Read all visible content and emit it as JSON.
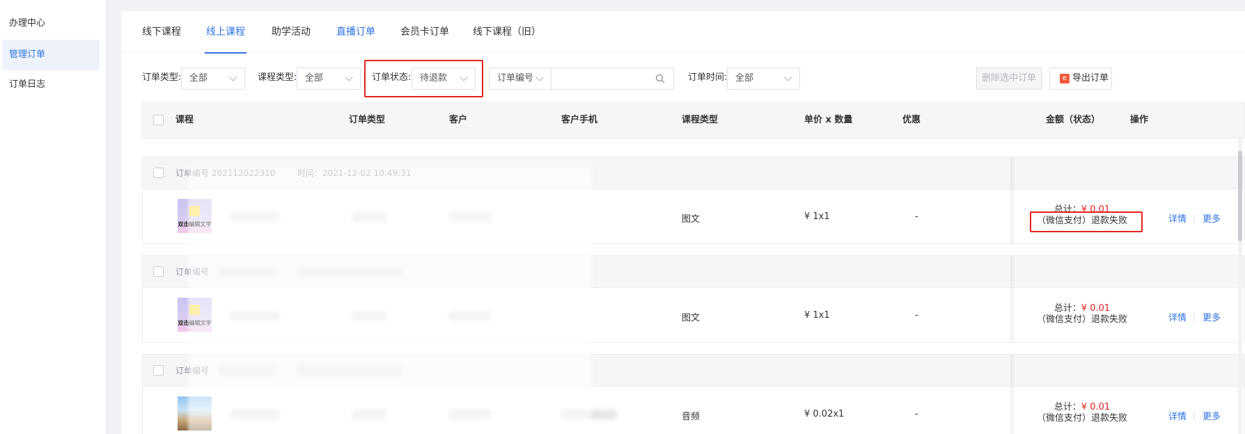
{
  "sidebar": {
    "items": [
      {
        "label": "办理中心",
        "active": false
      },
      {
        "label": "管理订单",
        "active": true
      },
      {
        "label": "订单日志",
        "active": false
      }
    ]
  },
  "tabs": [
    {
      "label": "线下课程",
      "active": false
    },
    {
      "label": "线上课程",
      "active": true
    },
    {
      "label": "助学活动",
      "active": false
    },
    {
      "label": "直播订单",
      "active": false
    },
    {
      "label": "会员卡订单",
      "active": false
    },
    {
      "label": "线下课程（旧）",
      "active": false
    }
  ],
  "filters": {
    "order_type": {
      "label": "订单类型:",
      "value": "全部"
    },
    "course_type": {
      "label": "课程类型:",
      "value": "全部"
    },
    "order_status": {
      "label": "订单状态:",
      "value": "待退款"
    },
    "order_no": {
      "field": "订单编号",
      "value": ""
    },
    "order_time": {
      "label": "订单时间:",
      "value": "全部"
    }
  },
  "actions": {
    "delete_selected": "删除选中订单",
    "export": "导出订单",
    "export_icon": "excel-icon"
  },
  "table": {
    "columns": [
      "课程",
      "订单类型",
      "客户",
      "客户手机",
      "课程类型",
      "单价 x 数量",
      "优惠",
      "金额（状态）",
      "操作"
    ],
    "orders": [
      {
        "order_no_label": "订单编号 202112022310",
        "time_label": "时间：2021-12-02 10:49:31",
        "thumb": "图文",
        "thumb_text": "双击编辑文字",
        "course_type": "图文",
        "price_qty": "¥ 1x1",
        "discount": "-",
        "total_label": "总计：",
        "total_value": "¥ 0.01",
        "status": "（微信支付）退款失败",
        "detail": "详情",
        "more": "更多"
      },
      {
        "order_no_label": "订单编号",
        "time_label": "",
        "thumb": "图文",
        "thumb_text": "双击编辑文字",
        "course_type": "图文",
        "price_qty": "¥ 1x1",
        "discount": "-",
        "total_label": "总计：",
        "total_value": "¥ 0.01",
        "status": "（微信支付）退款失败",
        "detail": "详情",
        "more": "更多"
      },
      {
        "order_no_label": "订单编号",
        "time_label": "",
        "thumb": "beach",
        "thumb_text": "",
        "course_type": "音频",
        "price_qty": "¥ 0.02x1",
        "discount": "-",
        "total_label": "总计：",
        "total_value": "¥ 0.01",
        "status": "（微信支付）退款失败",
        "detail": "详情",
        "more": "更多"
      }
    ]
  },
  "colors": {
    "accent": "#2c71e6",
    "highlight": "#e3221c",
    "price": "#e3221c"
  }
}
